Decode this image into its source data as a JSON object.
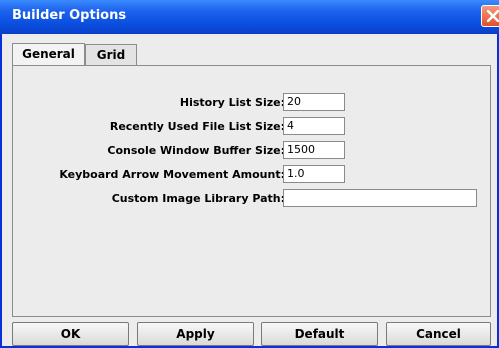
{
  "window": {
    "title": "Builder Options"
  },
  "tabs": [
    {
      "label": "General",
      "active": true
    },
    {
      "label": "Grid",
      "active": false
    }
  ],
  "fields": [
    {
      "label": "History List Size:",
      "value": "20"
    },
    {
      "label": "Recently Used File List Size:",
      "value": "4"
    },
    {
      "label": "Console Window Buffer Size:",
      "value": "1500"
    },
    {
      "label": "Keyboard Arrow Movement Amount:",
      "value": "1.0"
    },
    {
      "label": "Custom Image Library Path:",
      "value": ""
    }
  ],
  "buttons": {
    "ok": "OK",
    "apply": "Apply",
    "default": "Default",
    "cancel": "Cancel"
  },
  "icons": {
    "close": "close-icon"
  },
  "colors": {
    "titlebar": "#0a4fe0",
    "close": "#e0502a"
  }
}
